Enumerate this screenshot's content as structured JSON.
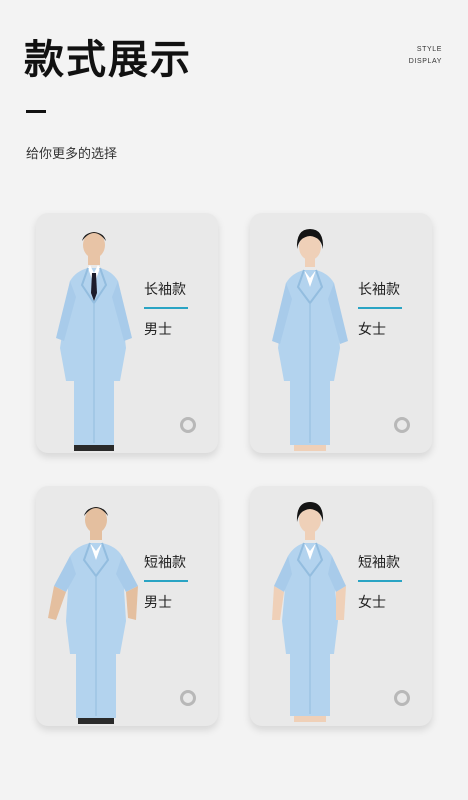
{
  "header": {
    "title": "款式展示",
    "label_line1": "STYLE",
    "label_line2": "DISPLAY",
    "subtitle": "给你更多的选择"
  },
  "colors": {
    "coat": "#b3d3ee",
    "coat_shadow": "#93bddf",
    "accent": "#2aa4c4",
    "card_bg": "#e9e9e9"
  },
  "cards": [
    {
      "style": "长袖款",
      "gender": "男士"
    },
    {
      "style": "长袖款",
      "gender": "女士"
    },
    {
      "style": "短袖款",
      "gender": "男士"
    },
    {
      "style": "短袖款",
      "gender": "女士"
    }
  ]
}
